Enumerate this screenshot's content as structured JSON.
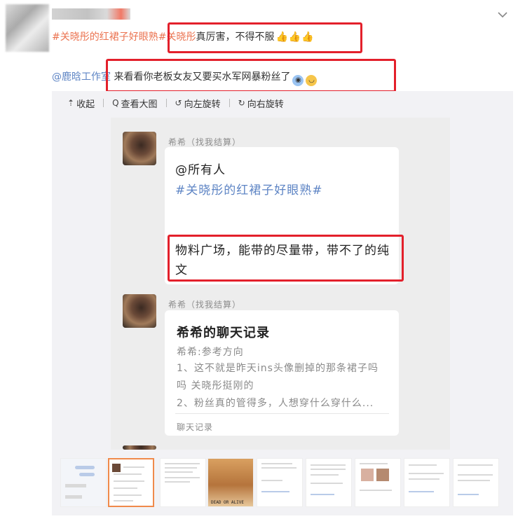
{
  "post": {
    "line1": {
      "topic": "#关晓彤的红裙子好眼熟#",
      "mention": "关晓彤",
      "text": "真厉害，不得不服",
      "thumbs": "👍👍👍"
    },
    "line2": {
      "mention": "@鹿晗工作室",
      "text": " 来看看你老板女友又要买水军网暴粉丝了"
    }
  },
  "toolbar": {
    "collapse": "收起",
    "view_large": "查看大图",
    "rotate_left": "向左旋转",
    "rotate_right": "向右旋转"
  },
  "chat": {
    "msg1": {
      "sender": "希希（找我结算）",
      "line1": "@所有人",
      "line2": "#关晓彤的红裙子好眼熟#",
      "line3": "物料广场，能带的尽量带，带不了的纯文"
    },
    "msg2": {
      "sender": "希希（找我结算）",
      "title": "希希的聊天记录",
      "subtitle": "希希:参考方向",
      "body": "1、这不就是昨天ins头像删掉的那条裙子吗吗 关晓彤挺刚的\n2、粉丝真的管得多，人想穿什么穿什么...",
      "footer": "聊天记录"
    }
  },
  "thumbnails": {
    "count": 9,
    "selected_index": 1,
    "thumb4_caption": "DEAD OR ALIVE"
  },
  "colors": {
    "topic": "#eb7350",
    "mention": "#5d84c4",
    "highlight_box": "#e3202b",
    "selected_thumb": "#f08a4b"
  }
}
